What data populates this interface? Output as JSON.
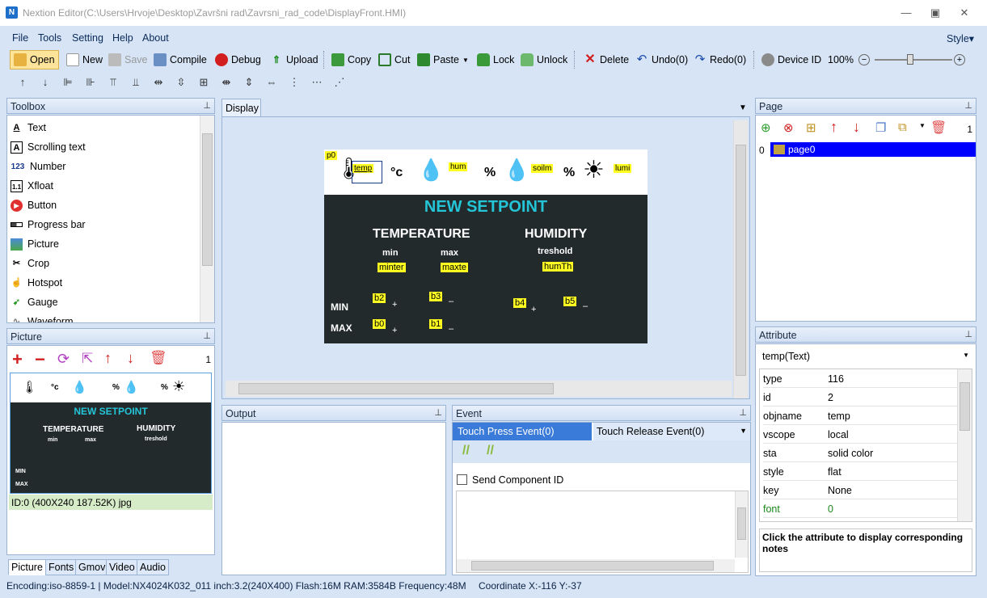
{
  "window": {
    "title": "Nextion Editor(C:\\Users\\Hrvoje\\Desktop\\Završni rad\\Zavrsni_rad_code\\DisplayFront.HMI)"
  },
  "menu": {
    "items": [
      "File",
      "Tools",
      "Setting",
      "Help",
      "About"
    ],
    "style": "Style"
  },
  "toolbar": {
    "open": "Open",
    "new": "New",
    "save": "Save",
    "compile": "Compile",
    "debug": "Debug",
    "upload": "Upload",
    "copy": "Copy",
    "cut": "Cut",
    "paste": "Paste",
    "lock": "Lock",
    "unlock": "Unlock",
    "delete": "Delete",
    "undo": "Undo(0)",
    "redo": "Redo(0)",
    "device_id": "Device  ID",
    "zoom": "100%"
  },
  "toolbox": {
    "title": "Toolbox",
    "items": [
      {
        "label": "Text",
        "icon": "text-icon"
      },
      {
        "label": "Scrolling text",
        "icon": "scrolling-text-icon"
      },
      {
        "label": "Number",
        "icon": "number-icon"
      },
      {
        "label": "Xfloat",
        "icon": "xfloat-icon"
      },
      {
        "label": "Button",
        "icon": "button-icon"
      },
      {
        "label": "Progress bar",
        "icon": "progress-bar-icon"
      },
      {
        "label": "Picture",
        "icon": "picture-icon"
      },
      {
        "label": "Crop",
        "icon": "crop-icon"
      },
      {
        "label": "Hotspot",
        "icon": "hotspot-icon"
      },
      {
        "label": "Gauge",
        "icon": "gauge-icon"
      },
      {
        "label": "Waveform",
        "icon": "waveform-icon"
      }
    ]
  },
  "picture_panel": {
    "title": "Picture",
    "count": "1",
    "info": "ID:0  (400X240 187.52K) jpg"
  },
  "bottom_tabs": [
    "Picture",
    "Fonts",
    "Gmov",
    "Video",
    "Audio"
  ],
  "display": {
    "tab": "Display",
    "screen": {
      "p0": "p0",
      "temp": "temp",
      "deg_c": "°c",
      "hum": "hum",
      "pct1": "%",
      "soilm": "soilm",
      "pct2": "%",
      "lumi": "lumi",
      "new_setpoint": "NEW SETPOINT",
      "temperature": "TEMPERATURE",
      "humidity": "HUMIDITY",
      "min": "min",
      "max": "max",
      "treshold": "treshold",
      "minter": "minter",
      "maxte": "maxte",
      "humTh": "humTh",
      "MIN": "MIN",
      "MAX": "MAX",
      "b2": "b2",
      "b3": "b3",
      "b0": "b0",
      "b1": "b1",
      "b4": "b4",
      "b5": "b5",
      "plus": "+",
      "minus": "–"
    }
  },
  "page_panel": {
    "title": "Page",
    "count": "1",
    "index": "0",
    "page": "page0"
  },
  "attribute_panel": {
    "title": "Attribute",
    "selected": "temp(Text)",
    "rows": [
      {
        "k": "type",
        "v": "116"
      },
      {
        "k": "id",
        "v": "2"
      },
      {
        "k": "objname",
        "v": "temp"
      },
      {
        "k": "vscope",
        "v": "local"
      },
      {
        "k": "sta",
        "v": "solid color"
      },
      {
        "k": "style",
        "v": "flat"
      },
      {
        "k": "key",
        "v": "None"
      },
      {
        "k": "font",
        "v": "0"
      }
    ],
    "note": "Click the attribute to display corresponding notes"
  },
  "output_panel": {
    "title": "Output"
  },
  "event_panel": {
    "title": "Event",
    "tab_press": "Touch Press Event(0)",
    "tab_release": "Touch Release Event(0)",
    "send_id": "Send Component ID"
  },
  "status": {
    "text": "Encoding:iso-8859-1 | Model:NX4024K032_011 inch:3.2(240X400) Flash:16M RAM:3584B Frequency:48M",
    "coord": "Coordinate X:-116  Y:-37"
  },
  "colors": {
    "accent": "#0a2a5a",
    "screen_bg": "#222a2c",
    "cyan": "#25c5d8",
    "selection": "#0000ff",
    "highlight": "#ffff22"
  }
}
